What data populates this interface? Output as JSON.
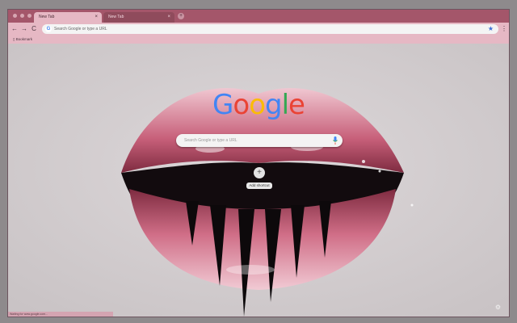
{
  "tabs": [
    {
      "label": "New Tab",
      "active": true
    },
    {
      "label": "New Tab",
      "active": false
    }
  ],
  "toolbar": {
    "back": "←",
    "forward": "→",
    "reload": "C",
    "omnibox_placeholder": "Search Google or type a URL",
    "menu": "⋮"
  },
  "bookmarks": {
    "item": "Bookmark"
  },
  "ntp": {
    "logo_letters": [
      "G",
      "o",
      "o",
      "g",
      "l",
      "e"
    ],
    "logo_colors": [
      "#4285f4",
      "#ea4335",
      "#fbbc05",
      "#4285f4",
      "#34a853",
      "#ea4335"
    ],
    "search_placeholder": "Search Google or type a URL",
    "shortcut_label": "Add shortcut",
    "shortcut_icon": "+"
  },
  "status_bar": "Waiting for www.google.com...",
  "theme": {
    "tabbar": "#a4566a",
    "active_tab": "#e6b8c4"
  }
}
